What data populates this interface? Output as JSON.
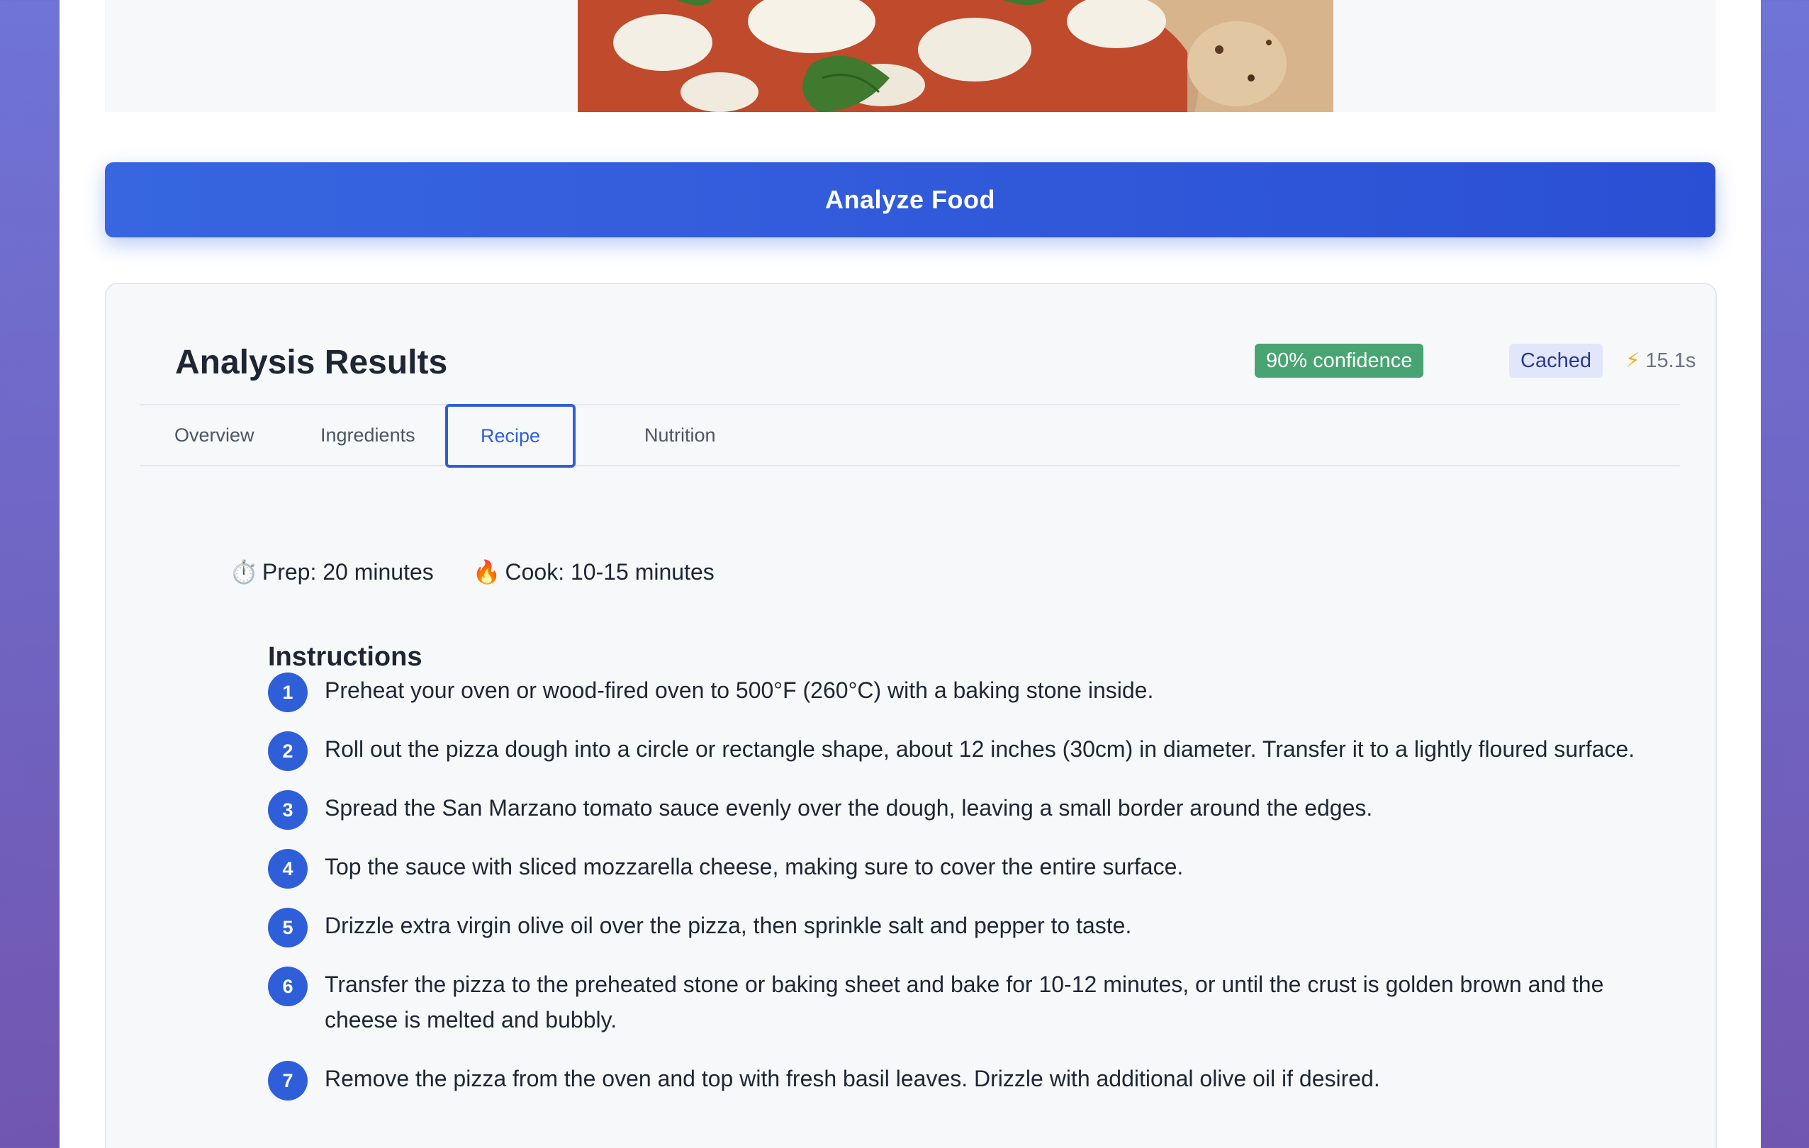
{
  "image": {
    "alt": "Margherita pizza with basil"
  },
  "analyze_button": {
    "label": "Analyze Food"
  },
  "results": {
    "title": "Analysis Results",
    "confidence_badge": "90% confidence",
    "cached_badge": "Cached",
    "timing_icon": "lightning-icon",
    "timing_text": "15.1s",
    "colors": {
      "accent": "#2f5fd8",
      "confidence_bg": "#48a472",
      "cached_bg": "#e2e6fb"
    }
  },
  "tabs": {
    "active": "Recipe",
    "items": [
      {
        "label": "Overview"
      },
      {
        "label": "Ingredients"
      },
      {
        "label": "Recipe"
      },
      {
        "label": "Nutrition"
      }
    ]
  },
  "recipe": {
    "prep_icon": "⏱️",
    "prep": "Prep: 20 minutes",
    "cook_icon": "🔥",
    "cook": "Cook: 10-15 minutes",
    "instructions_heading": "Instructions",
    "steps": [
      {
        "num": "1",
        "text": "Preheat your oven or wood-fired oven to 500°F (260°C) with a baking stone inside."
      },
      {
        "num": "2",
        "text": "Roll out the pizza dough into a circle or rectangle shape, about 12 inches (30cm) in diameter. Transfer it to a lightly floured surface."
      },
      {
        "num": "3",
        "text": "Spread the San Marzano tomato sauce evenly over the dough, leaving a small border around the edges."
      },
      {
        "num": "4",
        "text": "Top the sauce with sliced mozzarella cheese, making sure to cover the entire surface."
      },
      {
        "num": "5",
        "text": "Drizzle extra virgin olive oil over the pizza, then sprinkle salt and pepper to taste."
      },
      {
        "num": "6",
        "text": "Transfer the pizza to the preheated stone or baking sheet and bake for 10-12 minutes, or until the crust is golden brown and the cheese is melted and bubbly."
      },
      {
        "num": "7",
        "text": "Remove the pizza from the oven and top with fresh basil leaves. Drizzle with additional olive oil if desired."
      }
    ]
  }
}
